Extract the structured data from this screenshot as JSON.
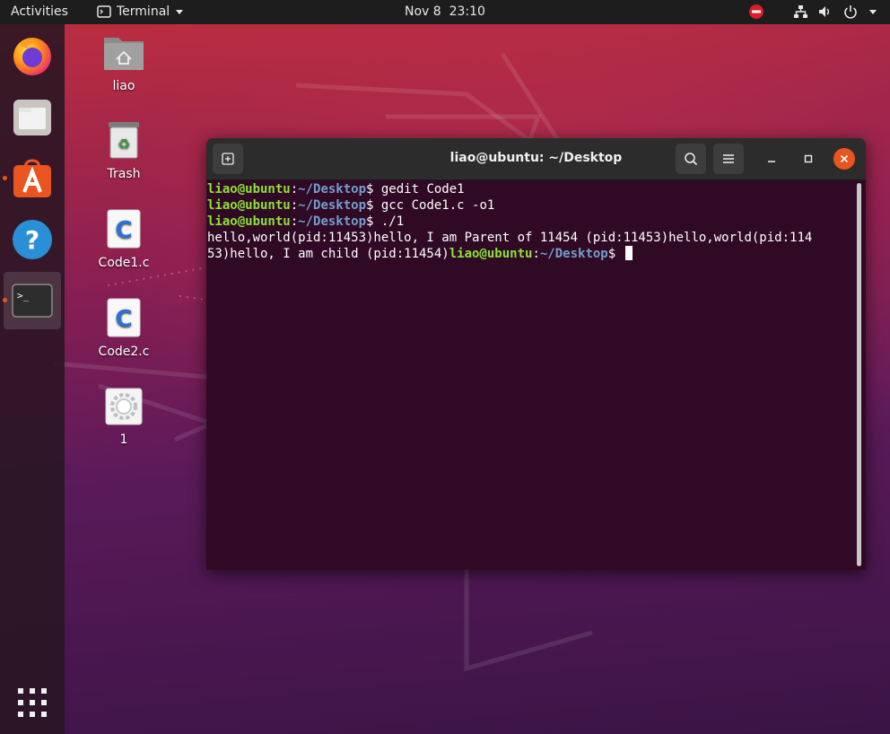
{
  "topbar": {
    "activities": "Activities",
    "app_name": "Terminal",
    "date": "Nov 8",
    "time": "23:10"
  },
  "dock": {
    "apps": [
      "firefox",
      "files",
      "ubuntu-software",
      "help",
      "terminal"
    ],
    "show_apps": "show-applications"
  },
  "desktop_icons": [
    {
      "label": "liao",
      "icon": "home-folder-icon"
    },
    {
      "label": "Trash",
      "icon": "trash-icon"
    },
    {
      "label": "Code1.c",
      "icon": "c-source-file-icon"
    },
    {
      "label": "Code2.c",
      "icon": "c-source-file-icon"
    },
    {
      "label": "1",
      "icon": "executable-gear-icon"
    }
  ],
  "terminal": {
    "title": "liao@ubuntu: ~/Desktop",
    "prompt_user": "liao@ubuntu",
    "prompt_path": "~/Desktop",
    "lines": [
      {
        "user": "liao@ubuntu",
        "sep": ":",
        "path": "~/Desktop",
        "cmd": "$ gedit Code1"
      },
      {
        "user": "liao@ubuntu",
        "sep": ":",
        "path": "~/Desktop",
        "cmd": "$ gcc Code1.c -o1"
      },
      {
        "user": "liao@ubuntu",
        "sep": ":",
        "path": "~/Desktop",
        "cmd": "$ ./1"
      }
    ],
    "output_line1": "hello,world(pid:11453)hello, I am Parent of 11454 (pid:11453)hello,world(pid:114",
    "output_line2": "53)hello, I am child (pid:11454)",
    "final_prompt_user": "liao@ubuntu",
    "final_prompt_sep": ":",
    "final_prompt_path": "~/Desktop",
    "final_prompt_dollar": "$ "
  },
  "colors": {
    "prompt_user": "#8ae234",
    "prompt_path": "#729fcf",
    "terminal_bg": "#300a24",
    "accent": "#e95420"
  }
}
